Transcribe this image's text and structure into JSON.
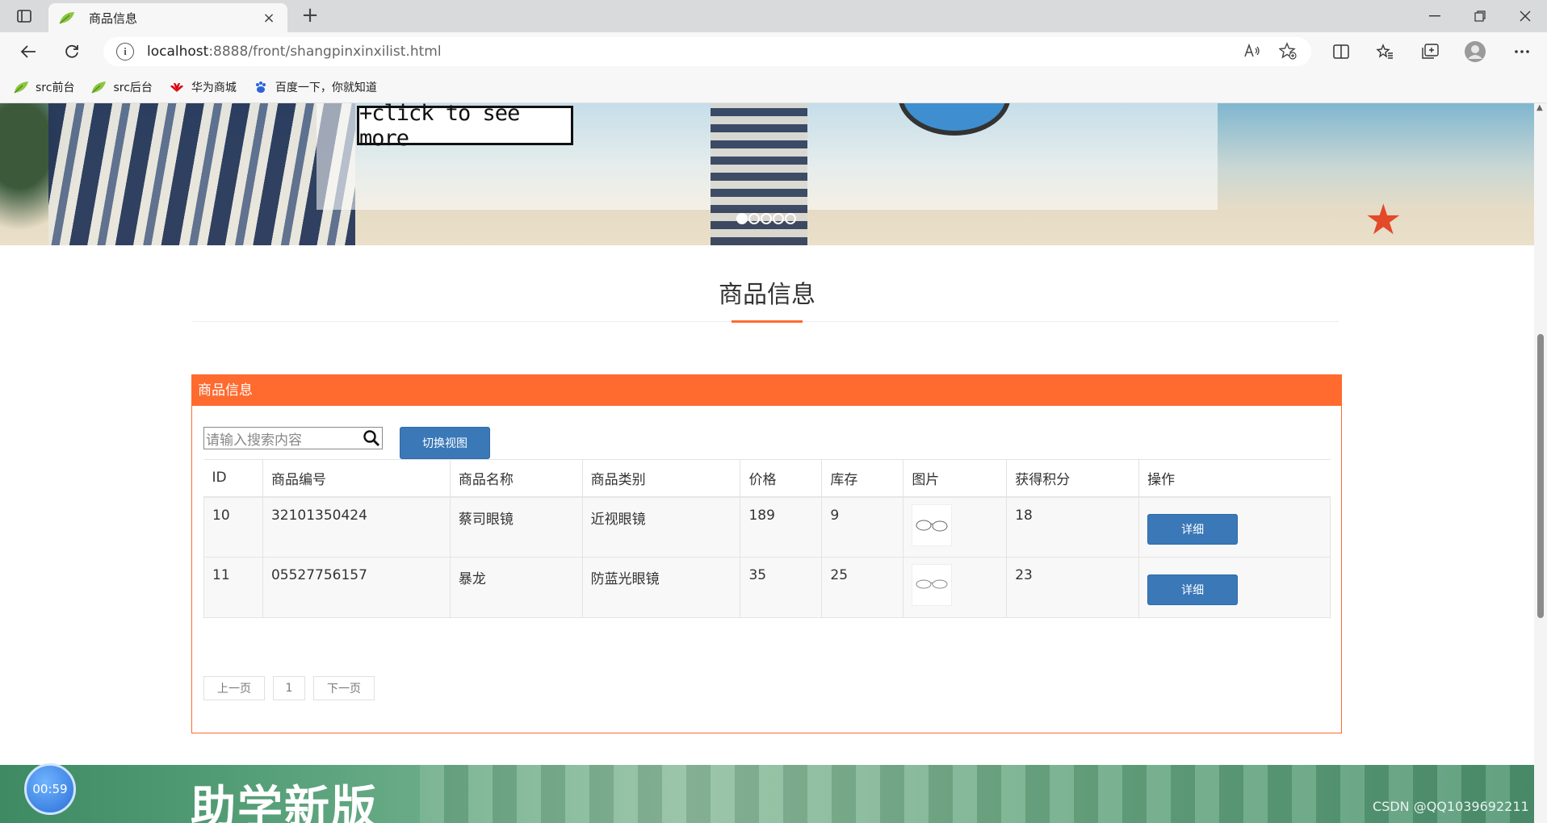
{
  "browser": {
    "tab_title": "商品信息",
    "tab_close": "×",
    "new_tab": "+",
    "url_host": "localhost",
    "url_rest": ":8888/front/shangpinxinxilist.html",
    "info_icon": "i",
    "bookmarks": [
      {
        "label": "src前台",
        "icon": "leaf-icon"
      },
      {
        "label": "src后台",
        "icon": "leaf-icon"
      },
      {
        "label": "华为商城",
        "icon": "huawei-icon"
      },
      {
        "label": "百度一下，你就知道",
        "icon": "baidu-paw-icon"
      }
    ]
  },
  "banner": {
    "more_label": "+click to see more",
    "dots_count": 5,
    "active_dot": 0
  },
  "page": {
    "section_title": "商品信息",
    "panel_title": "商品信息",
    "search_placeholder": "请输入搜索内容",
    "switch_view_label": "切换视图",
    "table": {
      "headers": [
        "ID",
        "商品编号",
        "商品名称",
        "商品类别",
        "价格",
        "库存",
        "图片",
        "获得积分",
        "操作"
      ],
      "rows": [
        {
          "id": "10",
          "code": "32101350424",
          "name": "蔡司眼镜",
          "category": "近视眼镜",
          "price": "189",
          "stock": "9",
          "points": "18",
          "action": "详细"
        },
        {
          "id": "11",
          "code": "05527756157",
          "name": "暴龙",
          "category": "防蓝光眼镜",
          "price": "35",
          "stock": "25",
          "points": "23",
          "action": "详细"
        }
      ]
    },
    "pager": {
      "prev": "上一页",
      "page": "1",
      "next": "下一页"
    }
  },
  "footer": {
    "title": "助学新版",
    "timer": "00:59",
    "watermark": "CSDN @QQ1039692211"
  },
  "colors": {
    "accent": "#ff6a2f",
    "button": "#3a78b8"
  }
}
